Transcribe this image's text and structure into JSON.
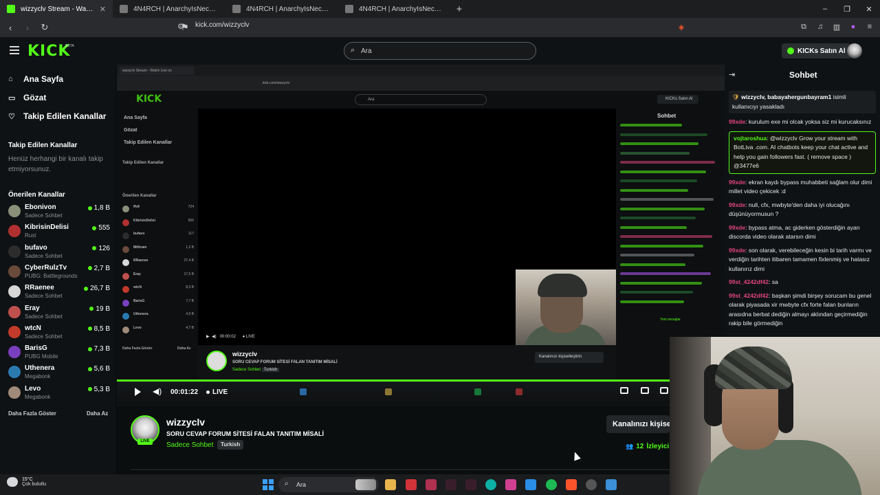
{
  "browser": {
    "tabs": [
      {
        "title": "wizzyclv Stream - Watch Live on Kick",
        "active": true,
        "fav_color": "#53fc18"
      },
      {
        "title": "4N4RCH | AnarchyIsNecessary",
        "active": false,
        "fav_color": "#777777"
      },
      {
        "title": "4N4RCH | AnarchyIsNecessary",
        "active": false,
        "fav_color": "#777777"
      },
      {
        "title": "4N4RCH | AnarchyIsNecessary",
        "active": false,
        "fav_color": "#777777"
      }
    ],
    "new_tab": "+",
    "url": "kick.com/wizzyclv",
    "window_controls": [
      "–",
      "❐",
      "✕"
    ]
  },
  "header": {
    "logo": "KICK",
    "logo_badge": "BETA",
    "search_placeholder": "Ara",
    "kicks_label": "KICKs Satın Al"
  },
  "sidebar": {
    "nav": [
      {
        "label": "Ana Sayfa",
        "icon": "home-icon",
        "glyph": "⌂"
      },
      {
        "label": "Gözat",
        "icon": "browse-icon",
        "glyph": "▭"
      },
      {
        "label": "Takip Edilen Kanallar",
        "icon": "heart-icon",
        "glyph": "♡"
      }
    ],
    "followed_title": "Takip Edilen Kanallar",
    "followed_empty": "Henüz herhangi bir kanalı takip etmiyorsunuz.",
    "recommended_title": "Önerilen Kanallar",
    "channels": [
      {
        "name": "Ebonivon",
        "category": "Sadece Sohbet",
        "viewers": "1,8 B",
        "color": "#8a8f7a"
      },
      {
        "name": "KibrisinDelisi",
        "category": "Rust",
        "viewers": "555",
        "color": "#b03030"
      },
      {
        "name": "bufavo",
        "category": "Sadece Sohbet",
        "viewers": "126",
        "color": "#2c2c2c"
      },
      {
        "name": "CyberRulzTv",
        "category": "PUBG: Battlegrounds",
        "viewers": "2,7 B",
        "color": "#6a4a3a"
      },
      {
        "name": "RRaenee",
        "category": "Sadece Sohbet",
        "viewers": "26,7 B",
        "color": "#d8d8d8"
      },
      {
        "name": "Eray",
        "category": "Sadece Sohbet",
        "viewers": "19 B",
        "color": "#c0504d"
      },
      {
        "name": "wtcN",
        "category": "Sadece Sohbet",
        "viewers": "8,5 B",
        "color": "#c23a2a"
      },
      {
        "name": "BarisG",
        "category": "PUBG Mobile",
        "viewers": "7,3 B",
        "color": "#7a3fbf"
      },
      {
        "name": "Uthenera",
        "category": "Megabonk",
        "viewers": "5,6 B",
        "color": "#2a7ab0"
      },
      {
        "name": "Levo",
        "category": "Megabonk",
        "viewers": "5,3 B",
        "color": "#a08a7a"
      }
    ],
    "show_more": "Daha Fazla Göster",
    "show_less": "Daha Az"
  },
  "player": {
    "time": "00:01:22",
    "live": "LIVE",
    "inner": {
      "tab_title": "wizzyclv Stream - Watch Live on",
      "url": "kick.com/wizzyclv",
      "logo": "KICK",
      "search": "Ara",
      "kicks": "KICKs Satın Al",
      "nav": [
        "Ana Sayfa",
        "Gözat",
        "Takip Edilen Kanallar"
      ],
      "followed_title": "Takip Edilen Kanallar",
      "recommended_title": "Önerilen Kanallar",
      "channels": [
        {
          "name": "ffv9",
          "viewers": "724"
        },
        {
          "name": "KibrisinDelisi",
          "viewers": "555"
        },
        {
          "name": "bufavo",
          "viewers": "117"
        },
        {
          "name": "Mithrain",
          "viewers": "1,2 B"
        },
        {
          "name": "RRaenee",
          "viewers": "27,4 B"
        },
        {
          "name": "Eray",
          "viewers": "17,5 B"
        },
        {
          "name": "wtcN",
          "viewers": "8,3 B"
        },
        {
          "name": "BarisG",
          "viewers": "7,7 B"
        },
        {
          "name": "Uthenera",
          "viewers": "4,9 B"
        },
        {
          "name": "Levo",
          "viewers": "4,7 B"
        }
      ],
      "show_more": "Daha Fazla Göster",
      "show_less": "Daha Az",
      "time": "00:00:02",
      "live": "LIVE",
      "chat_title": "Sohbet",
      "new_messages": "Yeni mesajlar",
      "channel_name": "wizzyclv",
      "stream_title": "SORU CEVAP FORUM SİTESİ FALAN TANITIM MİSALİ",
      "category": "Sadece Sohbet",
      "tag": "Turkish",
      "customize": "Kanalınızı kişiselleştirin"
    }
  },
  "channel": {
    "name": "wizzyclv",
    "live_badge": "LIVE",
    "title": "SORU CEVAP FORUM SİTESİ FALAN TANITIM MİSALİ",
    "category": "Sadece Sohbet",
    "tag": "Turkish",
    "customize_button": "Kanalınızı kişise",
    "viewers_count": "12",
    "viewers_label": "İzleyici"
  },
  "chat": {
    "title": "Sohbet",
    "messages": [
      {
        "type": "sys",
        "user": "wizzyclv, babayahergunbayram1",
        "text": " isimli kullanıcıyı yasakladı",
        "color": "#ffffff"
      },
      {
        "type": "msg",
        "user": "99xde",
        "text": ": kurulum exe mi olcak yoksa siz mi kurucaksınız",
        "color": "#e0457b"
      },
      {
        "type": "hl",
        "user": "vojtaroshua",
        "text": ": @wizzyclv Grow your stream with BotLiva .com. AI chatbots keep your chat active and help you gain followers fast. ( remove space ) @3477e6",
        "color": "#53fc18"
      },
      {
        "type": "msg",
        "user": "99xde",
        "text": ": ekran kaydı bypass muhabbeti sağlam olur dimi millet video çekicek :d",
        "color": "#e0457b"
      },
      {
        "type": "msg",
        "user": "99xde",
        "text": ": null, cfx, mwbyte'den daha iyi olucağını düşünüyormusun ?",
        "color": "#e0457b"
      },
      {
        "type": "msg",
        "user": "99xde",
        "text": ": bypass atma, ac giderken gösterdiğin ayarı discorda video olarak atarsın dimi",
        "color": "#e0457b"
      },
      {
        "type": "msg",
        "user": "99xde",
        "text": ": son olarak, verebileceğin kesin bi tarih varmı ve verdiğin tarihten itibaren tamamen fixlenmiş ve hatasız kullanırız dimi",
        "color": "#e0457b"
      },
      {
        "type": "msg",
        "user": "99st_4242df42",
        "text": ": sa",
        "color": "#e0457b"
      },
      {
        "type": "msg",
        "user": "99st_4242df42",
        "text": ": başkan şimdi birşey sorucam bu genel olarak piyasada xir mwbyte cfx forte falan bunların arasıdna berbat dediğin almayı aklından geçirmediğin rakip bile görmediğin",
        "color": "#e0457b"
      }
    ]
  },
  "taskbar": {
    "temp": "15°C",
    "weather": "Çok bulutlu",
    "search_placeholder": "Ara"
  }
}
